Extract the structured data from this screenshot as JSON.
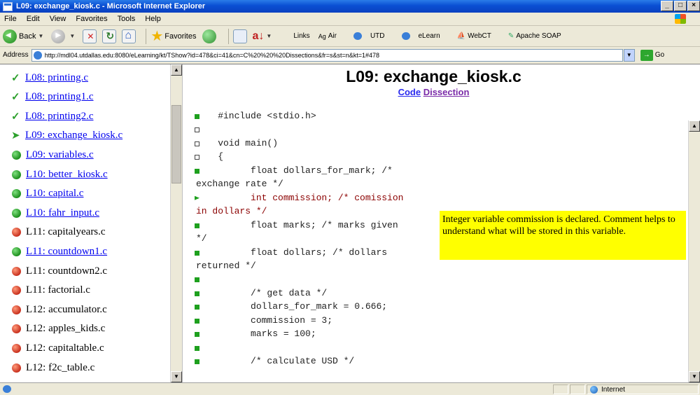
{
  "window": {
    "title": "L09: exchange_kiosk.c - Microsoft Internet Explorer",
    "controls": [
      "_",
      "□",
      "×"
    ]
  },
  "menu": [
    "File",
    "Edit",
    "View",
    "Favorites",
    "Tools",
    "Help"
  ],
  "toolbar": {
    "back": "Back",
    "favorites": "Favorites",
    "links_label": "Links",
    "links": [
      "Air",
      "UTD",
      "eLearn",
      "WebCT",
      "Apache SOAP"
    ]
  },
  "address": {
    "label": "Address",
    "url": "http://mdl04.utdallas.edu:8080/eLearning/kt/TShow?id=478&ci=41&cn=C%20%20%20Dissections&fr=s&st=n&kt=1#478",
    "go": "Go"
  },
  "sidebar": {
    "items": [
      {
        "label": "L08: printing.c",
        "status": "done",
        "link": true
      },
      {
        "label": "L08: printing1.c",
        "status": "done",
        "link": true
      },
      {
        "label": "L08: printing2.c",
        "status": "done",
        "link": true
      },
      {
        "label": "L09: exchange_kiosk.c",
        "status": "current",
        "link": true
      },
      {
        "label": "L09: variables.c",
        "status": "green",
        "link": true
      },
      {
        "label": "L10: better_kiosk.c",
        "status": "green",
        "link": true
      },
      {
        "label": "L10: capital.c",
        "status": "green",
        "link": true
      },
      {
        "label": "L10: fahr_input.c",
        "status": "green",
        "link": true
      },
      {
        "label": "L11: capitalyears.c",
        "status": "red",
        "link": false
      },
      {
        "label": "L11: countdown1.c",
        "status": "green",
        "link": true
      },
      {
        "label": "L11: countdown2.c",
        "status": "red",
        "link": false
      },
      {
        "label": "L11: factorial.c",
        "status": "red",
        "link": false
      },
      {
        "label": "L12: accumulator.c",
        "status": "red",
        "link": false
      },
      {
        "label": "L12: apples_kids.c",
        "status": "red",
        "link": false
      },
      {
        "label": "L12: capitaltable.c",
        "status": "red",
        "link": false
      },
      {
        "label": "L12: f2c_table.c",
        "status": "red",
        "link": false
      }
    ]
  },
  "main": {
    "title": "L09: exchange_kiosk.c",
    "links": {
      "code": "Code",
      "dissection": "Dissection"
    },
    "code_lines": [
      {
        "marker": "filled",
        "text": "    #include <stdio.h>"
      },
      {
        "marker": "hollow",
        "text": ""
      },
      {
        "marker": "hollow",
        "text": "    void main()"
      },
      {
        "marker": "hollow",
        "text": "    {"
      },
      {
        "marker": "filled",
        "text": "          float dollars_for_mark; /*"
      },
      {
        "marker": "none",
        "text": "exchange rate */"
      },
      {
        "marker": "flag",
        "text": "          int commission; /* comission",
        "highlight": true
      },
      {
        "marker": "none",
        "text": "in dollars */",
        "highlight": true
      },
      {
        "marker": "filled",
        "text": "          float marks; /* marks given"
      },
      {
        "marker": "none",
        "text": "*/"
      },
      {
        "marker": "filled",
        "text": "          float dollars; /* dollars"
      },
      {
        "marker": "none",
        "text": "returned */"
      },
      {
        "marker": "filled",
        "text": ""
      },
      {
        "marker": "filled",
        "text": "          /* get data */"
      },
      {
        "marker": "filled",
        "text": "          dollars_for_mark = 0.666;"
      },
      {
        "marker": "filled",
        "text": "          commission = 3;"
      },
      {
        "marker": "filled",
        "text": "          marks = 100;"
      },
      {
        "marker": "filled",
        "text": ""
      },
      {
        "marker": "filled",
        "text": "          /* calculate USD */"
      }
    ],
    "tooltip": "Integer variable commission is declared. Comment helps to understand what will be stored in this variable."
  },
  "statusbar": {
    "zone": "Internet"
  }
}
